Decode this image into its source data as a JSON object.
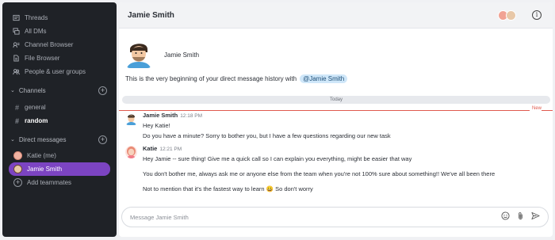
{
  "sidebar": {
    "nav": [
      {
        "label": "Threads",
        "icon": "threads-icon"
      },
      {
        "label": "All DMs",
        "icon": "all-dms-icon"
      },
      {
        "label": "Channel Browser",
        "icon": "channel-browser-icon"
      },
      {
        "label": "File Browser",
        "icon": "file-browser-icon"
      },
      {
        "label": "People & user groups",
        "icon": "people-icon"
      }
    ],
    "channels_label": "Channels",
    "channels": [
      {
        "label": "general"
      },
      {
        "label": "random"
      }
    ],
    "dms_label": "Direct messages",
    "dms": [
      {
        "label": "Katie (me)"
      },
      {
        "label": "Jamie Smith"
      }
    ],
    "add_teammates": "Add teammates"
  },
  "header": {
    "title": "Jamie Smith",
    "info_glyph": "i"
  },
  "intro": {
    "name": "Jamie Smith",
    "beginning_text": "This is the very beginning of your direct message history with",
    "mention": "@Jamie Smith"
  },
  "divider": {
    "today": "Today",
    "new": "New"
  },
  "messages": [
    {
      "author": "Jamie Smith",
      "time": "12:18 PM",
      "lines": [
        "Hey Katie!",
        "Do you have a minute? Sorry to bother you, but I have a few questions regarding our new task"
      ]
    },
    {
      "author": "Katie",
      "time": "12:21 PM",
      "lines": [
        "Hey Jamie -- sure thing! Give me a quick call so I can explain you everything, might be easier that way",
        "You don't bother me, always ask me or anyone else from the team when you're not 100% sure about something!! We've all been there",
        "Not to mention that it's the fastest way to learn 😀 So don't worry"
      ]
    }
  ],
  "composer": {
    "placeholder": "Message Jamie Smith"
  },
  "colors": {
    "sidebar_bg": "#1f2227",
    "active": "#7c44c2",
    "new_line": "#e05a4e",
    "mention_bg": "#cfe7f9"
  }
}
